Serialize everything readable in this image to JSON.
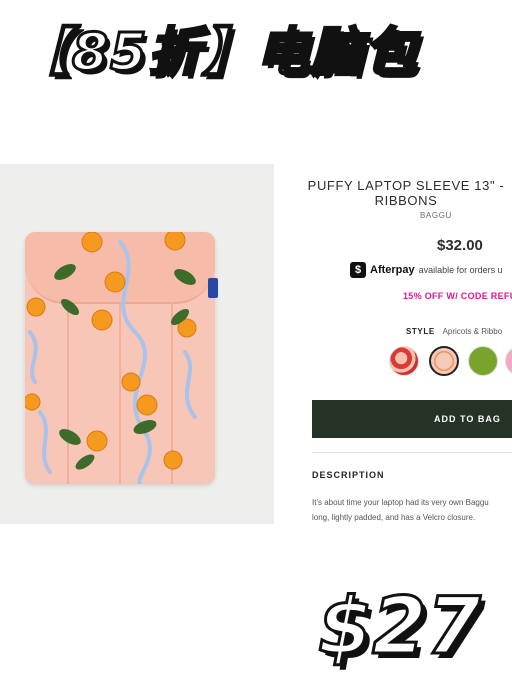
{
  "banner": {
    "text": "【85折】电脑包"
  },
  "product": {
    "title": "PUFFY LAPTOP SLEEVE 13\" - RIBBONS",
    "brand": "BAGGU",
    "price": "$32.00",
    "afterpay": {
      "brand": "Afterpay",
      "text": "available for orders u"
    },
    "promo": "15% OFF W/ CODE REFU",
    "style": {
      "label": "STYLE",
      "value": "Apricots & Ribbo"
    },
    "swatches": [
      "strawberry",
      "apricots-ribbons",
      "green",
      "pink"
    ],
    "add_to_bag": "ADD TO BAG",
    "description": {
      "title": "DESCRIPTION",
      "line1": "It's about time your laptop had its very own Baggu",
      "line2": "long, lightly padded, and has a Velcro closure."
    }
  },
  "sale_price": "$27",
  "colors": {
    "button_bg": "#243326",
    "promo": "#e3168b",
    "sleeve": "#f8c6b7"
  }
}
